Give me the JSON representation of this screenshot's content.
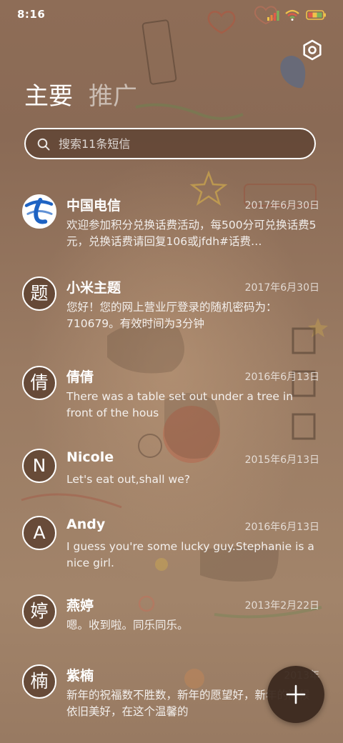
{
  "status_bar": {
    "time": "8:16"
  },
  "tabs": [
    {
      "label": "主要"
    },
    {
      "label": "推广"
    }
  ],
  "search": {
    "placeholder": "搜索11条短信"
  },
  "messages": [
    {
      "avatar_text": "",
      "avatar_icon": "china-telecom-logo-icon",
      "name": "中国电信",
      "date": "2017年6月30日",
      "preview": "欢迎参加积分兑换话费活动，每500分可兑换话费5元，兑换话费请回复106或jfdh#话费…"
    },
    {
      "avatar_text": "题",
      "name": "小米主题",
      "date": "2017年6月30日",
      "preview": "您好！您的网上营业厅登录的随机密码为：710679。有效时间为3分钟"
    },
    {
      "avatar_text": "倩",
      "name": "倩倩",
      "date": "2016年6月13日",
      "preview": "There was a table set out under a tree in front of the hous"
    },
    {
      "avatar_text": "N",
      "name": "Nicole",
      "date": "2015年6月13日",
      "preview": "Let's eat out,shall we?"
    },
    {
      "avatar_text": "A",
      "name": "Andy",
      "date": "2016年6月13日",
      "preview": "I guess you're some lucky guy.Stephanie is a nice girl."
    },
    {
      "avatar_text": "婷",
      "name": "燕婷",
      "date": "2013年2月22日",
      "preview": "嗯。收到啦。同乐同乐。"
    },
    {
      "avatar_text": "楠",
      "name": "紫楠",
      "date": "2013年",
      "preview": "新年的祝福数不胜数，新年的愿望好，新年的问候依旧美好，在这个温馨的"
    }
  ],
  "icons": {
    "settings": "gear-icon",
    "search": "search-icon",
    "compose": "plus-icon",
    "signal": "signal-icon",
    "wifi": "wifi-icon",
    "battery": "battery-icon"
  },
  "colors": {
    "wallpaper_base": "#8a6a54",
    "text": "#ffffff",
    "fab": "#3a281e",
    "telecom_blue": "#1e63c3"
  }
}
